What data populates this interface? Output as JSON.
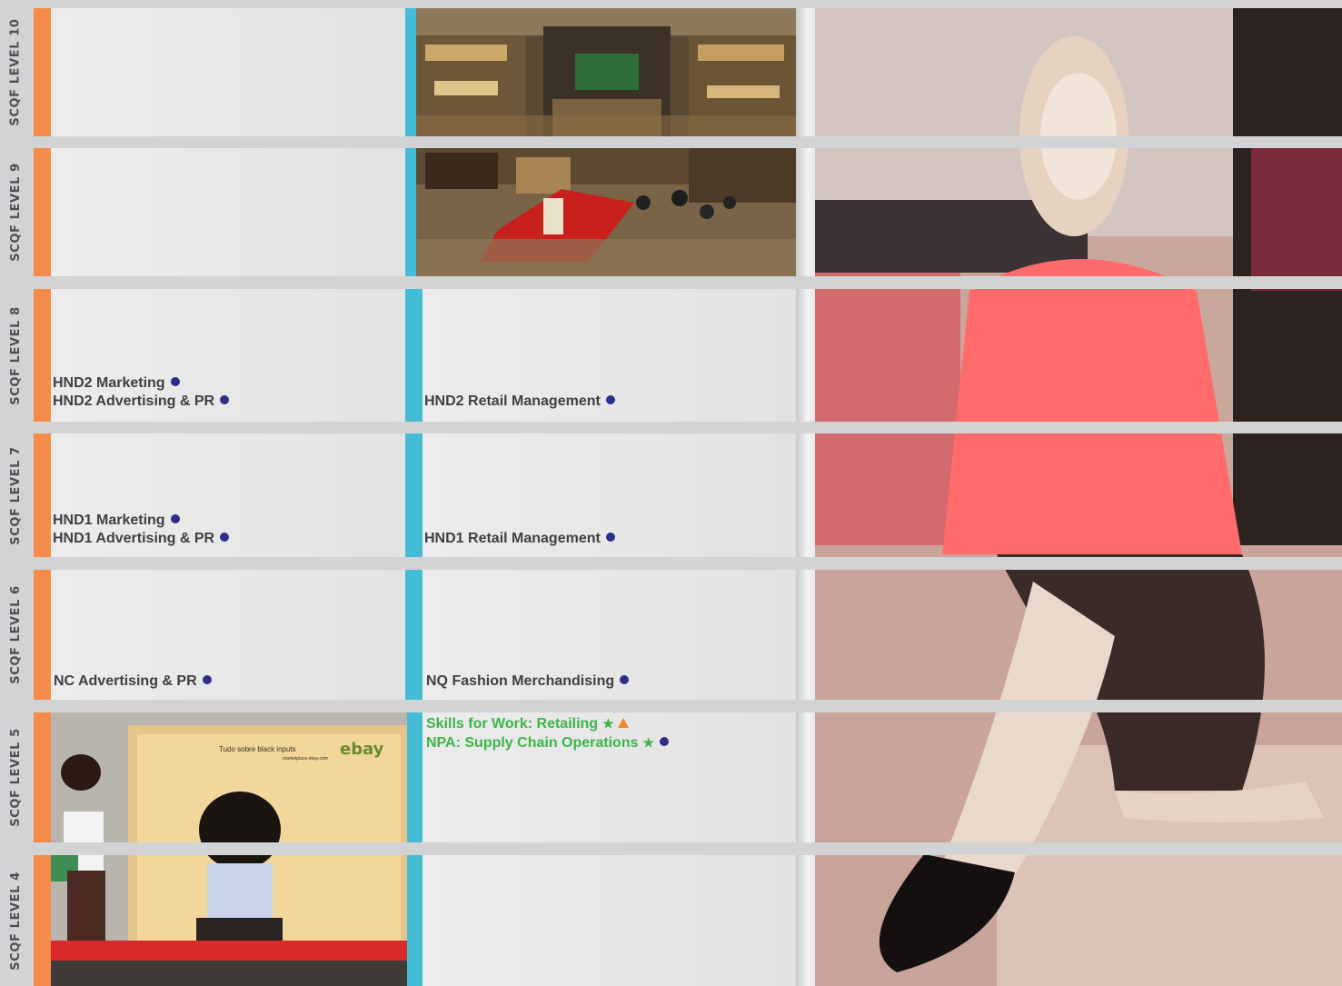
{
  "levels": [
    {
      "label": "SCQF LEVEL 10"
    },
    {
      "label": "SCQF LEVEL 9"
    },
    {
      "label": "SCQF LEVEL 8"
    },
    {
      "label": "SCQF LEVEL 7"
    },
    {
      "label": "SCQF LEVEL 6"
    },
    {
      "label": "SCQF LEVEL 5"
    },
    {
      "label": "SCQF LEVEL 4"
    }
  ],
  "courses": {
    "level8_col1": [
      "HND2 Marketing",
      "HND2 Advertising & PR"
    ],
    "level8_col2": [
      "HND2 Retail Management"
    ],
    "level7_col1": [
      "HND1 Marketing",
      "HND1 Advertising & PR"
    ],
    "level7_col2": [
      "HND1 Retail Management"
    ],
    "level6_col1": [
      "NC Advertising & PR"
    ],
    "level6_col2": [
      "NQ Fashion Merchandising"
    ],
    "level5_col2": [
      "Skills for Work: Retailing",
      "NPA: Supply Chain Operations"
    ]
  },
  "ad_text": {
    "line1": "Tudo sobre black inputs",
    "logo": "ebay",
    "small": "marketplace.ebay.com"
  },
  "colors": {
    "orange_stripe": "#f58a4b",
    "cyan_stripe": "#45bcd6",
    "dot_blue": "#2b2f87",
    "green": "#3cb54a",
    "triangle_orange": "#f08a24"
  }
}
